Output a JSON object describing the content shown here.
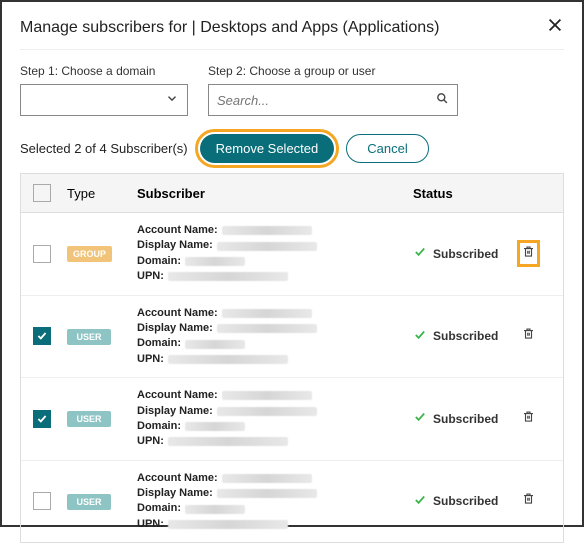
{
  "dialog": {
    "title": "Manage subscribers for | Desktops and Apps (Applications)"
  },
  "steps": {
    "step1_label": "Step 1: Choose a domain",
    "step2_label": "Step 2: Choose a group or user",
    "search_placeholder": "Search..."
  },
  "selection": {
    "text": "Selected 2 of 4 Subscriber(s)",
    "remove_label": "Remove Selected",
    "cancel_label": "Cancel"
  },
  "headers": {
    "type": "Type",
    "subscriber": "Subscriber",
    "status": "Status"
  },
  "field_labels": {
    "account": "Account Name:",
    "display": "Display Name:",
    "domain": "Domain:",
    "upn": "UPN:"
  },
  "rows": [
    {
      "checked": false,
      "type": "GROUP",
      "type_class": "group",
      "status": "Subscribed",
      "delete_highlight": true
    },
    {
      "checked": true,
      "type": "USER",
      "type_class": "user",
      "status": "Subscribed",
      "delete_highlight": false
    },
    {
      "checked": true,
      "type": "USER",
      "type_class": "user",
      "status": "Subscribed",
      "delete_highlight": false
    },
    {
      "checked": false,
      "type": "USER",
      "type_class": "user",
      "status": "Subscribed",
      "delete_highlight": false
    }
  ]
}
